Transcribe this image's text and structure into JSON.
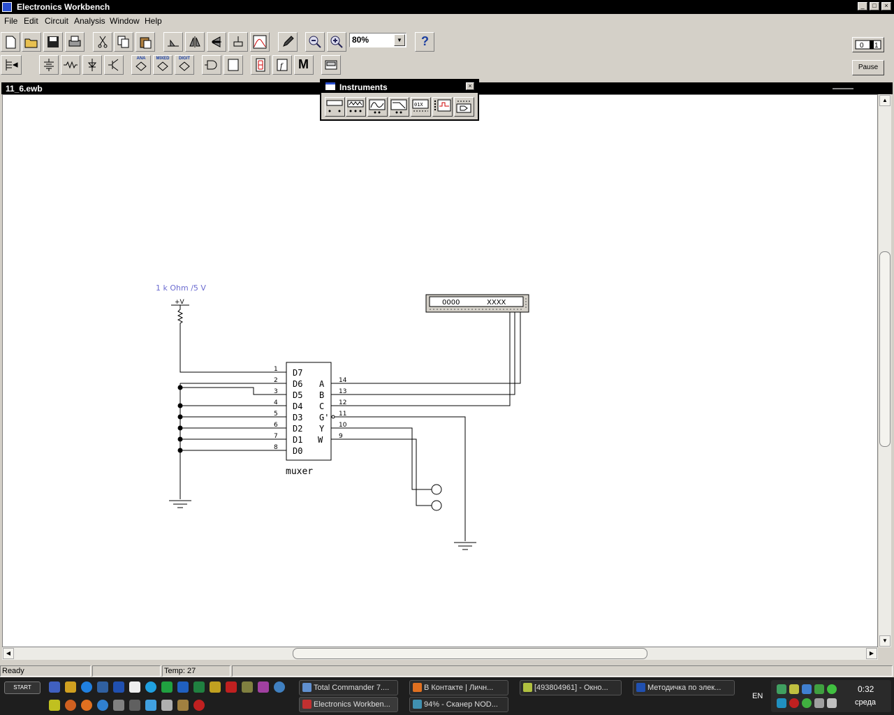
{
  "window": {
    "title": "Electronics Workbench"
  },
  "menu": [
    "File",
    "Edit",
    "Circuit",
    "Analysis",
    "Window",
    "Help"
  ],
  "toolbar": {
    "zoom_value": "80%",
    "help_label": "?",
    "pause_label": "Pause",
    "ana_label": "ANA",
    "mixed_label": "MIXED",
    "digit_label": "DIGIT",
    "misc_label": "M"
  },
  "document": {
    "title": "11_6.ewb"
  },
  "instruments": {
    "title": "Instruments"
  },
  "circuit": {
    "source_label": "1 k Ohm /5 V",
    "vcc_label": "+V",
    "muxer_label": "muxer",
    "data_inputs": [
      "D7",
      "D6",
      "D5",
      "D4",
      "D3",
      "D2",
      "D1",
      "D0"
    ],
    "input_pins": [
      "1",
      "2",
      "3",
      "4",
      "5",
      "6",
      "7",
      "8"
    ],
    "select_outputs": [
      "A",
      "B",
      "C",
      "G'",
      "Y",
      "W"
    ],
    "output_pins": [
      "14",
      "13",
      "12",
      "11",
      "10",
      "9"
    ],
    "word_gen_left": "0000",
    "word_gen_right": "XXXX"
  },
  "status": {
    "ready": "Ready",
    "temp": "Temp: 27"
  },
  "taskbar": {
    "start_label": "START",
    "tasks": [
      "Total Commander 7....",
      "В Контакте | Личн...",
      "[493804961] - Окно...",
      "Методичка по элек...",
      "Electronics Workben...",
      "94% - Сканер NOD..."
    ],
    "lang": "EN",
    "time": "0:32",
    "day": "среда"
  }
}
